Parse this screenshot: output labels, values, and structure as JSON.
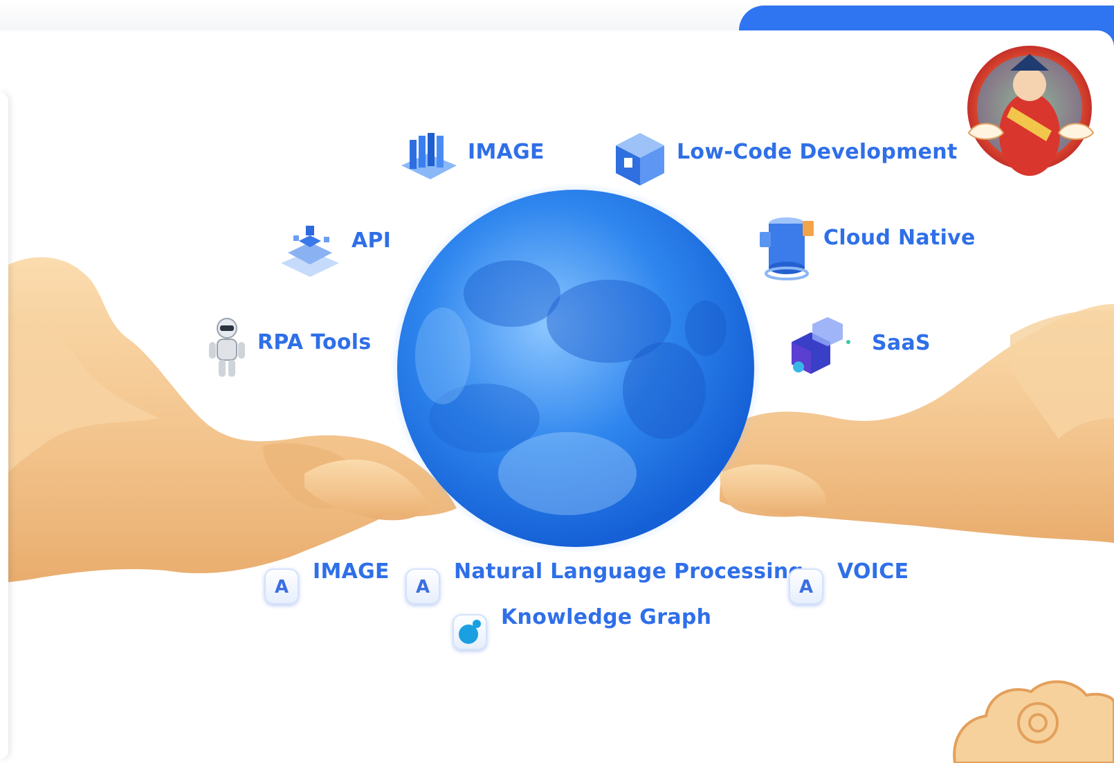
{
  "features": {
    "image_top": "IMAGE",
    "low_code": "Low-Code Development",
    "api": "API",
    "cloud_native": "Cloud Native",
    "rpa_tools": "RPA Tools",
    "saas": "SaaS"
  },
  "ai_capabilities": {
    "image": "IMAGE",
    "nlp": "Natural Language Processing",
    "voice": "VOICE",
    "knowledge_graph": "Knowledge Graph",
    "chip_glyph": "A"
  },
  "colors": {
    "accent": "#2f74f0",
    "label": "#2f6fe8",
    "moon": "#2a7be6",
    "cloud": "#f3c58f"
  },
  "icons": {
    "image_top": "server-blade-icon",
    "low_code": "blocks-icon",
    "api": "stacked-cubes-icon",
    "cloud_native": "database-cylinder-icon",
    "rpa_tools": "robot-icon",
    "saas": "hexagon-cube-icon",
    "knowledge_graph": "graph-node-icon",
    "mascot": "fortune-god-mascot-icon"
  }
}
